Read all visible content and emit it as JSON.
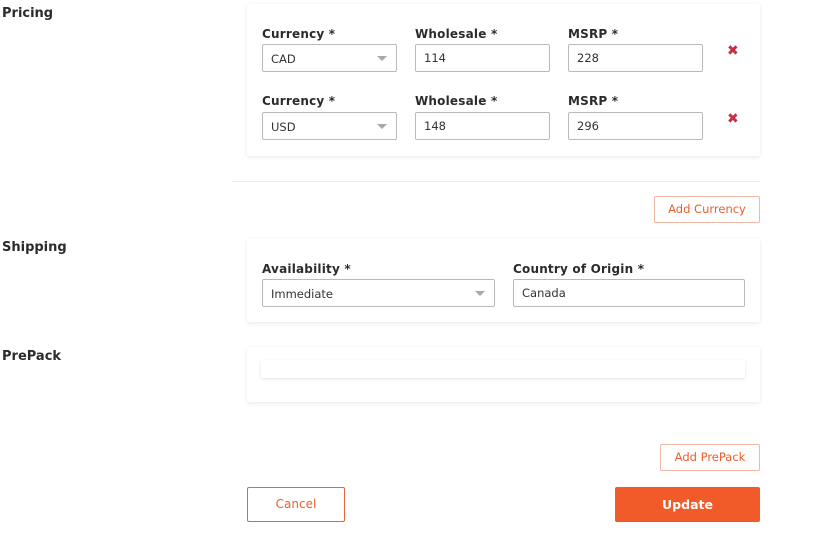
{
  "pricing": {
    "title": "Pricing",
    "rows": [
      {
        "currency_label": "Currency *",
        "currency_value": "CAD",
        "wholesale_label": "Wholesale *",
        "wholesale_value": "114",
        "msrp_label": "MSRP *",
        "msrp_value": "228",
        "remove_glyph": "✖"
      },
      {
        "currency_label": "Currency *",
        "currency_value": "USD",
        "wholesale_label": "Wholesale *",
        "wholesale_value": "148",
        "msrp_label": "MSRP *",
        "msrp_value": "296",
        "remove_glyph": "✖"
      }
    ],
    "add_currency_label": "Add Currency"
  },
  "shipping": {
    "title": "Shipping",
    "availability_label": "Availability *",
    "availability_value": "Immediate",
    "country_label": "Country of Origin *",
    "country_value": "Canada"
  },
  "prepack": {
    "title": "PrePack",
    "add_prepack_label": "Add PrePack"
  },
  "actions": {
    "cancel_label": "Cancel",
    "update_label": "Update"
  },
  "colors": {
    "accent": "#f15a29",
    "remove": "#c62f46"
  },
  "icons": {
    "remove": "close-x-icon",
    "dropdown": "chevron-down-icon"
  }
}
